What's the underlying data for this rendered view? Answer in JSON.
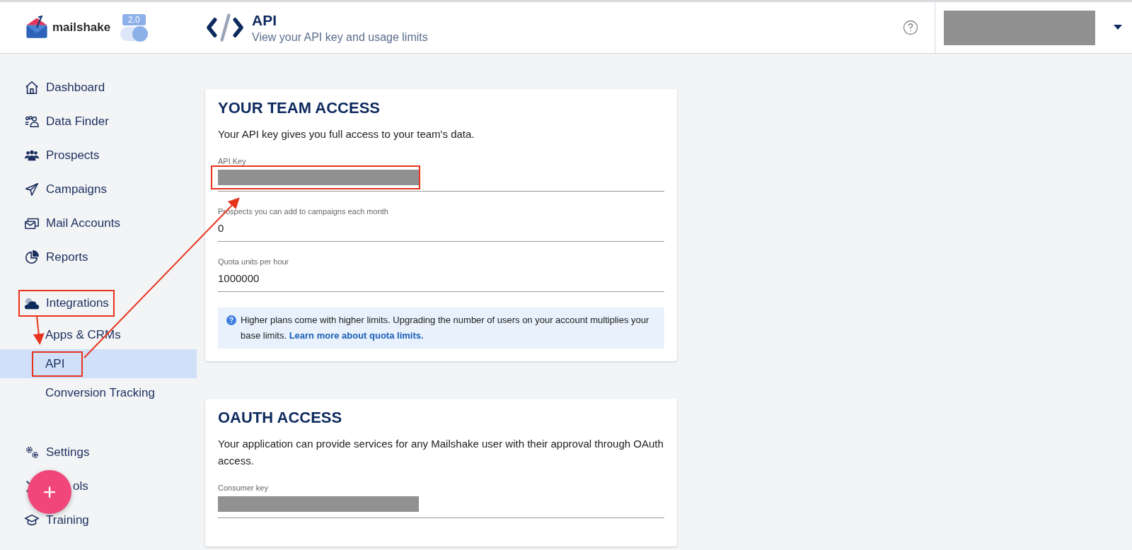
{
  "header": {
    "logo": "mailshake",
    "version_badge": "2.0",
    "version_toggle": {
      "on": true
    },
    "page_title": "API",
    "page_subtitle": "View your API key and usage limits",
    "account": {
      "redacted": true
    }
  },
  "sidebar": {
    "items": [
      {
        "label": "Dashboard",
        "selected": false,
        "annotated": false
      },
      {
        "label": "Data Finder",
        "selected": false,
        "annotated": false
      },
      {
        "label": "Prospects",
        "selected": false,
        "annotated": false
      },
      {
        "label": "Campaigns",
        "selected": false,
        "annotated": false
      },
      {
        "label": "Mail Accounts",
        "selected": false,
        "annotated": false
      },
      {
        "label": "Reports",
        "selected": false,
        "annotated": false
      },
      {
        "label": "Integrations",
        "selected": false,
        "annotated": true,
        "children": [
          {
            "label": "Apps & CRMs",
            "selected": false,
            "annotated": false
          },
          {
            "label": "API",
            "selected": true,
            "annotated": true
          },
          {
            "label": "Conversion Tracking",
            "selected": false,
            "annotated": false
          }
        ]
      },
      {
        "label": "Settings",
        "selected": false,
        "annotated": false
      },
      {
        "label": "ols",
        "selected": false,
        "annotated": false
      },
      {
        "label": "Training",
        "selected": false,
        "annotated": false
      }
    ]
  },
  "fab": {
    "label": "+"
  },
  "cards": [
    {
      "title": "YOUR TEAM ACCESS",
      "description": "Your API key gives you full access to your team's data.",
      "fields": [
        {
          "label": "API Key",
          "kind": "redacted",
          "annotated": true
        },
        {
          "label": "Prospects you can add to campaigns each month",
          "kind": "text",
          "value": "0",
          "annotated": false
        },
        {
          "label": "Quota units per hour",
          "kind": "text",
          "value": "1000000",
          "annotated": false
        }
      ],
      "note": {
        "text": "Higher plans come with higher limits. Upgrading the number of users on your account multiplies your base limits.",
        "link": "Learn more about quota limits."
      }
    },
    {
      "title": "OAUTH ACCESS",
      "description": "Your application can provide services for any Mailshake user with their approval through OAuth access.",
      "fields": [
        {
          "label": "Consumer key",
          "kind": "redacted",
          "annotated": false
        }
      ]
    }
  ]
}
